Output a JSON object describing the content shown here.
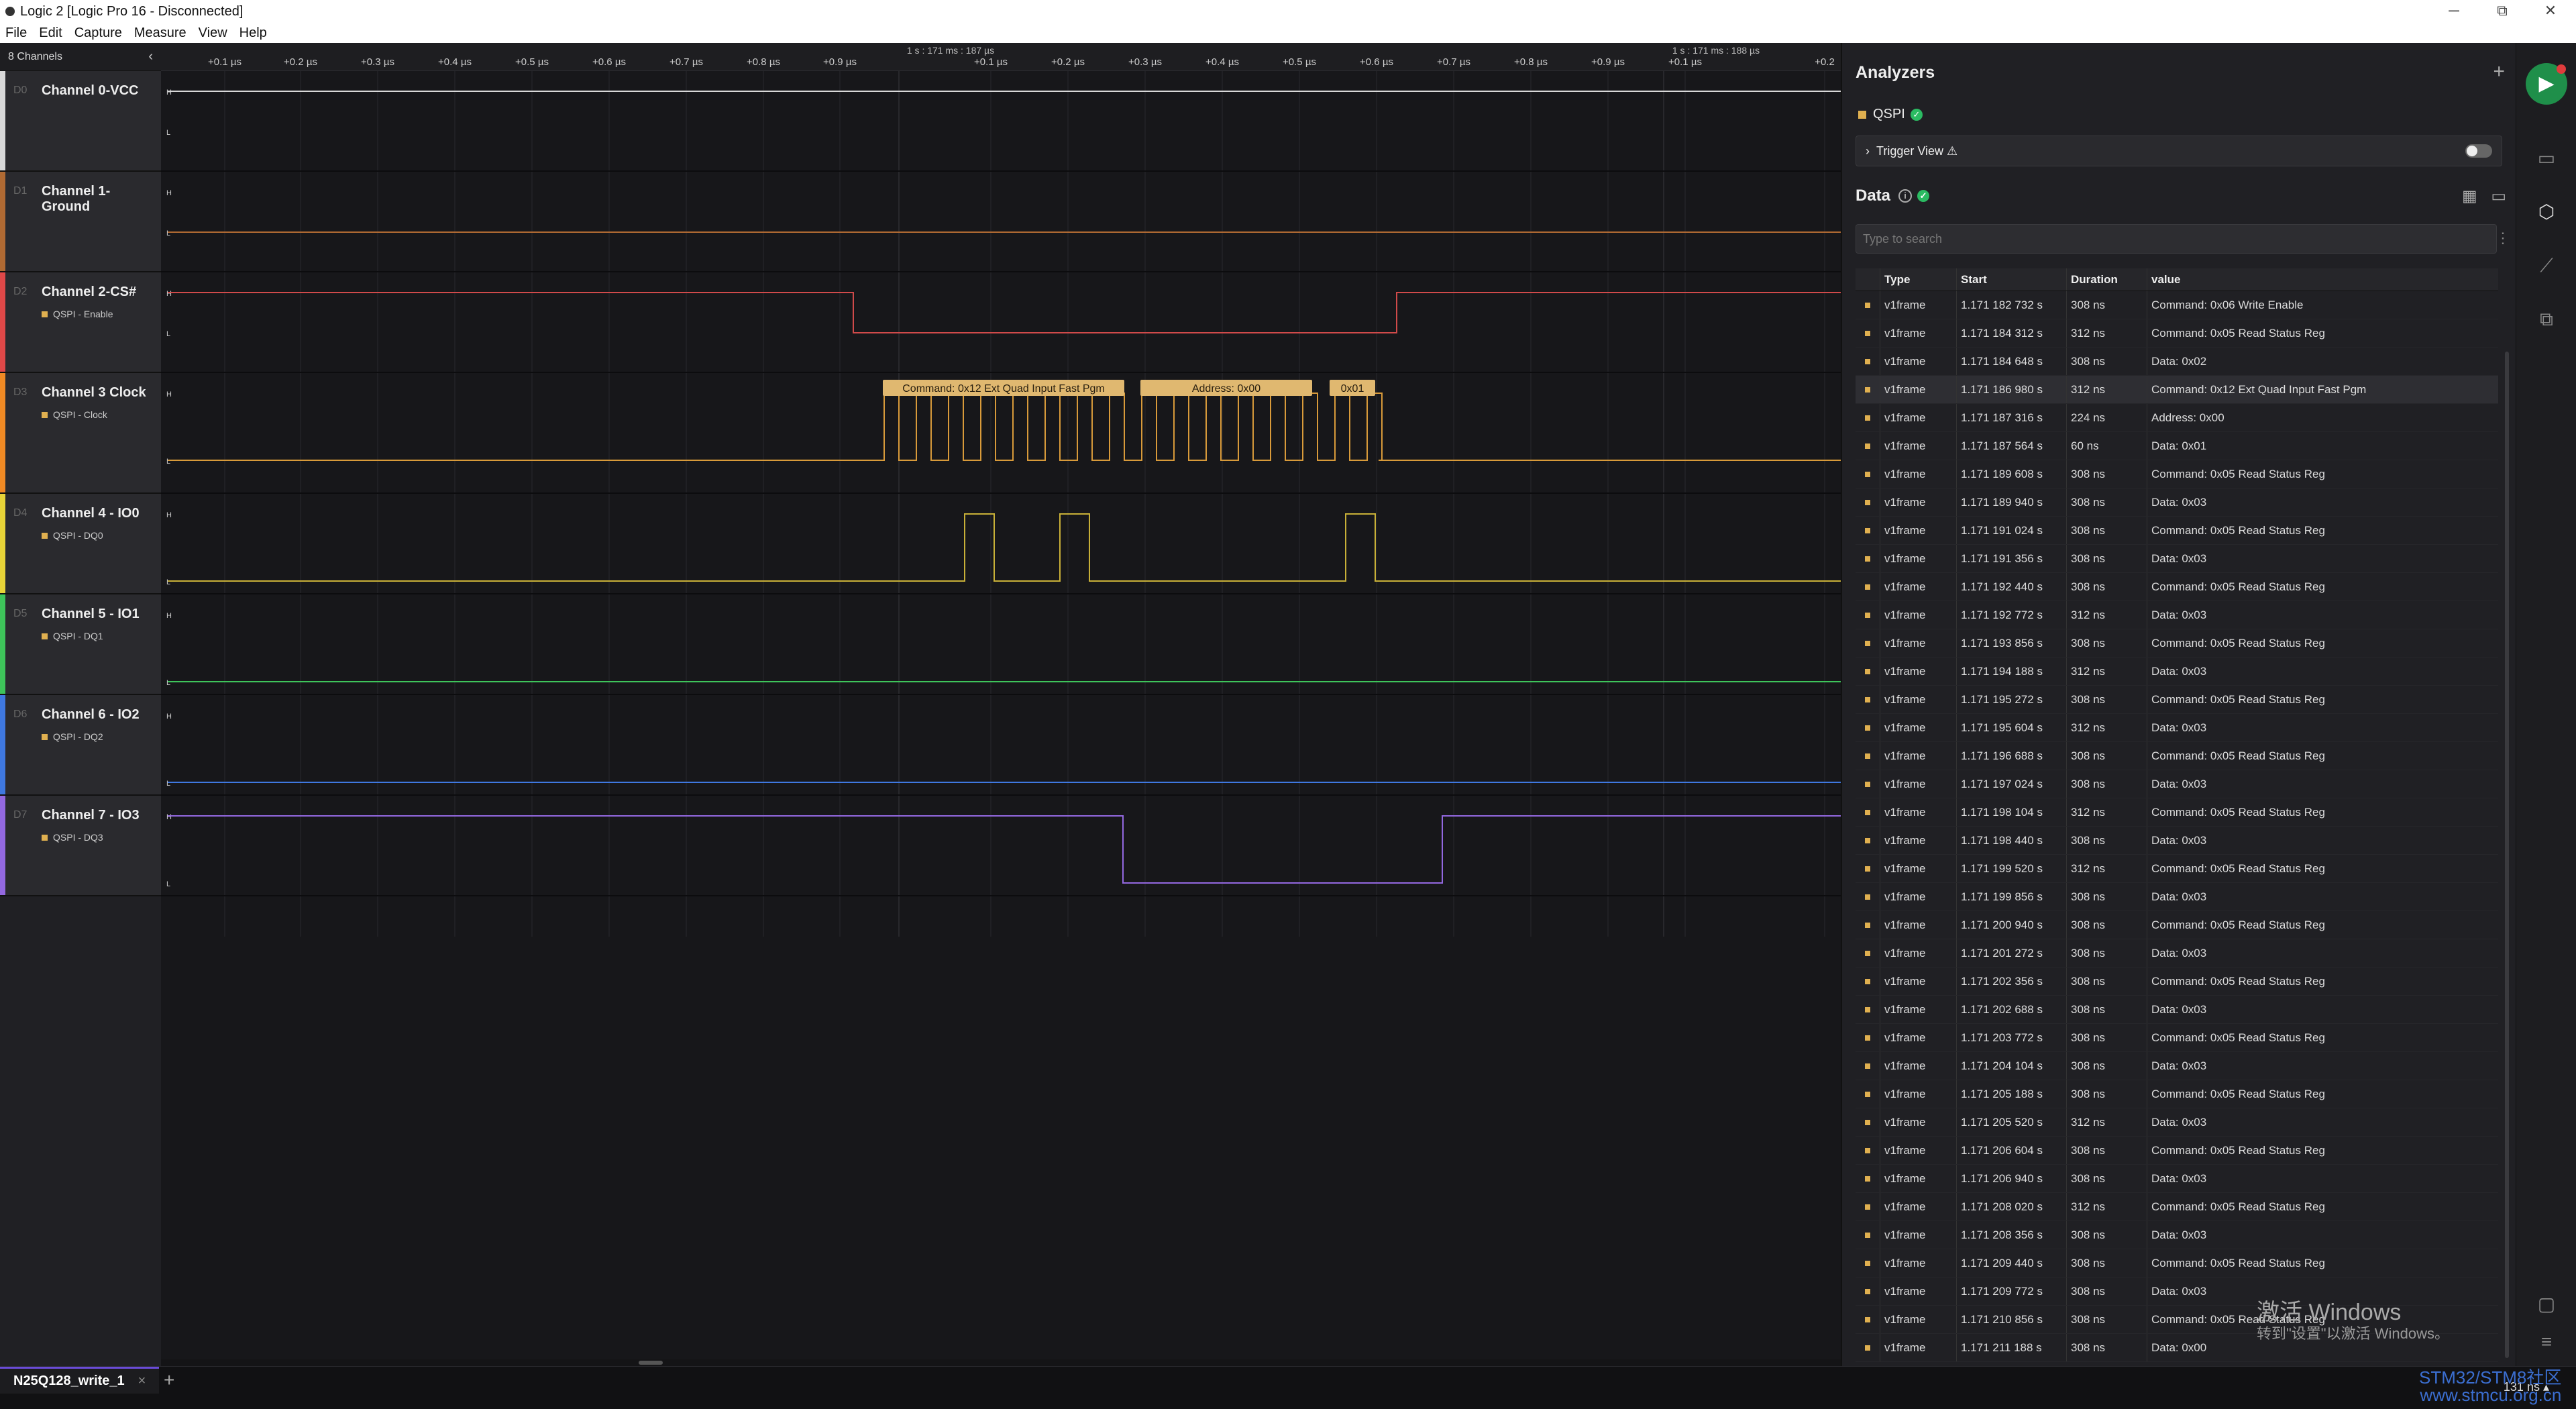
{
  "window": {
    "title": "Logic 2 [Logic Pro 16 - Disconnected]",
    "minimize": "─",
    "maximize": "⧉",
    "close": "✕"
  },
  "menu": [
    "File",
    "Edit",
    "Capture",
    "Measure",
    "View",
    "Help"
  ],
  "channels_header": {
    "label": "8 Channels",
    "collapse_icon": "chevron-left-icon"
  },
  "channels": [
    {
      "num": "D0",
      "name": "Channel 0-VCC",
      "color": "#d8d8d8",
      "analyzer": ""
    },
    {
      "num": "D1",
      "name": "Channel 1- Ground",
      "color": "#b06a33",
      "analyzer": ""
    },
    {
      "num": "D2",
      "name": "Channel 2-CS#",
      "color": "#e04848",
      "analyzer": "QSPI - Enable"
    },
    {
      "num": "D3",
      "name": "Channel 3 Clock",
      "color": "#f08a24",
      "analyzer": "QSPI - Clock"
    },
    {
      "num": "D4",
      "name": "Channel 4 - IO0",
      "color": "#e8d438",
      "analyzer": "QSPI - DQ0"
    },
    {
      "num": "D5",
      "name": "Channel 5 - IO1",
      "color": "#3ec45a",
      "analyzer": "QSPI - DQ1"
    },
    {
      "num": "D6",
      "name": "Channel 6 - IO2",
      "color": "#3f78e0",
      "analyzer": "QSPI - DQ2"
    },
    {
      "num": "D7",
      "name": "Channel 7 - IO3",
      "color": "#9368e0",
      "analyzer": "QSPI - DQ3"
    }
  ],
  "ruler": {
    "ticks": [
      "+0.1 µs",
      "+0.2 µs",
      "+0.3 µs",
      "+0.4 µs",
      "+0.5 µs",
      "+0.6 µs",
      "+0.7 µs",
      "+0.8 µs",
      "+0.9 µs",
      "+0.1 µs",
      "+0.2 µs",
      "+0.3 µs",
      "+0.4 µs",
      "+0.5 µs",
      "+0.6 µs",
      "+0.7 µs",
      "+0.8 µs",
      "+0.9 µs",
      "+0.1 µs",
      "+0.2"
    ],
    "markers": [
      "1 s : 171 ms : 187 µs",
      "1 s : 171 ms : 188 µs"
    ]
  },
  "level_labels": {
    "high": "H",
    "low": "L"
  },
  "decode_labels": [
    "Command: 0x12 Ext Quad Input Fast Pgm",
    "Address: 0x00",
    "0x01"
  ],
  "analyzers": {
    "title": "Analyzers",
    "add": "+",
    "name": "QSPI",
    "status": "✓"
  },
  "trigger": {
    "label": "Trigger View ⚠",
    "toggle_on": false
  },
  "data": {
    "title": "Data",
    "info": "i",
    "search_placeholder": "Type to search",
    "columns": [
      "Type",
      "Start",
      "Duration",
      "value"
    ],
    "rows": [
      [
        "v1frame",
        "1.171 182 732 s",
        "308 ns",
        "Command: 0x06 Write Enable"
      ],
      [
        "v1frame",
        "1.171 184 312 s",
        "312 ns",
        "Command: 0x05 Read Status Reg"
      ],
      [
        "v1frame",
        "1.171 184 648 s",
        "308 ns",
        "Data: 0x02"
      ],
      [
        "v1frame",
        "1.171 186 980 s",
        "312 ns",
        "Command: 0x12 Ext Quad Input Fast Pgm"
      ],
      [
        "v1frame",
        "1.171 187 316 s",
        "224 ns",
        "Address: 0x00"
      ],
      [
        "v1frame",
        "1.171 187 564 s",
        "60 ns",
        "Data: 0x01"
      ],
      [
        "v1frame",
        "1.171 189 608 s",
        "308 ns",
        "Command: 0x05 Read Status Reg"
      ],
      [
        "v1frame",
        "1.171 189 940 s",
        "308 ns",
        "Data: 0x03"
      ],
      [
        "v1frame",
        "1.171 191 024 s",
        "308 ns",
        "Command: 0x05 Read Status Reg"
      ],
      [
        "v1frame",
        "1.171 191 356 s",
        "308 ns",
        "Data: 0x03"
      ],
      [
        "v1frame",
        "1.171 192 440 s",
        "308 ns",
        "Command: 0x05 Read Status Reg"
      ],
      [
        "v1frame",
        "1.171 192 772 s",
        "312 ns",
        "Data: 0x03"
      ],
      [
        "v1frame",
        "1.171 193 856 s",
        "308 ns",
        "Command: 0x05 Read Status Reg"
      ],
      [
        "v1frame",
        "1.171 194 188 s",
        "312 ns",
        "Data: 0x03"
      ],
      [
        "v1frame",
        "1.171 195 272 s",
        "308 ns",
        "Command: 0x05 Read Status Reg"
      ],
      [
        "v1frame",
        "1.171 195 604 s",
        "312 ns",
        "Data: 0x03"
      ],
      [
        "v1frame",
        "1.171 196 688 s",
        "308 ns",
        "Command: 0x05 Read Status Reg"
      ],
      [
        "v1frame",
        "1.171 197 024 s",
        "308 ns",
        "Data: 0x03"
      ],
      [
        "v1frame",
        "1.171 198 104 s",
        "312 ns",
        "Command: 0x05 Read Status Reg"
      ],
      [
        "v1frame",
        "1.171 198 440 s",
        "308 ns",
        "Data: 0x03"
      ],
      [
        "v1frame",
        "1.171 199 520 s",
        "312 ns",
        "Command: 0x05 Read Status Reg"
      ],
      [
        "v1frame",
        "1.171 199 856 s",
        "308 ns",
        "Data: 0x03"
      ],
      [
        "v1frame",
        "1.171 200 940 s",
        "308 ns",
        "Command: 0x05 Read Status Reg"
      ],
      [
        "v1frame",
        "1.171 201 272 s",
        "308 ns",
        "Data: 0x03"
      ],
      [
        "v1frame",
        "1.171 202 356 s",
        "308 ns",
        "Command: 0x05 Read Status Reg"
      ],
      [
        "v1frame",
        "1.171 202 688 s",
        "308 ns",
        "Data: 0x03"
      ],
      [
        "v1frame",
        "1.171 203 772 s",
        "308 ns",
        "Command: 0x05 Read Status Reg"
      ],
      [
        "v1frame",
        "1.171 204 104 s",
        "308 ns",
        "Data: 0x03"
      ],
      [
        "v1frame",
        "1.171 205 188 s",
        "308 ns",
        "Command: 0x05 Read Status Reg"
      ],
      [
        "v1frame",
        "1.171 205 520 s",
        "312 ns",
        "Data: 0x03"
      ],
      [
        "v1frame",
        "1.171 206 604 s",
        "308 ns",
        "Command: 0x05 Read Status Reg"
      ],
      [
        "v1frame",
        "1.171 206 940 s",
        "308 ns",
        "Data: 0x03"
      ],
      [
        "v1frame",
        "1.171 208 020 s",
        "312 ns",
        "Command: 0x05 Read Status Reg"
      ],
      [
        "v1frame",
        "1.171 208 356 s",
        "308 ns",
        "Data: 0x03"
      ],
      [
        "v1frame",
        "1.171 209 440 s",
        "308 ns",
        "Command: 0x05 Read Status Reg"
      ],
      [
        "v1frame",
        "1.171 209 772 s",
        "308 ns",
        "Data: 0x03"
      ],
      [
        "v1frame",
        "1.171 210 856 s",
        "308 ns",
        "Command: 0x05 Read Status Reg"
      ],
      [
        "v1frame",
        "1.171 211 188 s",
        "308 ns",
        "Data: 0x00"
      ]
    ]
  },
  "bottom": {
    "tab": "N25Q128_write_1",
    "tab_close": "×",
    "add_tab": "+",
    "zoom": "131 ns ▴"
  },
  "watermark": {
    "line1": "激活 Windows",
    "line2": "转到\"设置\"以激活 Windows。",
    "site1": "STM32/STM8社区",
    "site2": "www.stmcu.org.cn"
  }
}
